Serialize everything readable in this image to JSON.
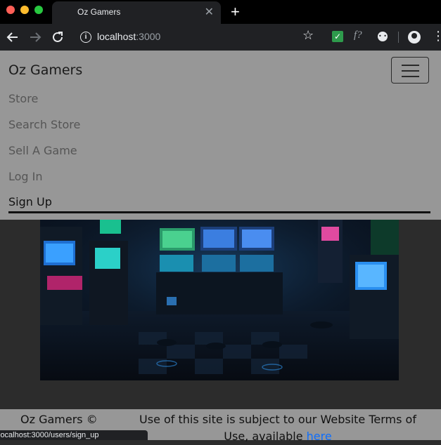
{
  "browser": {
    "tab_title": "Oz Gamers",
    "close_glyph": "✕",
    "new_tab_glyph": "+",
    "url_host": "localhost",
    "url_port": ":3000",
    "status_url": "localhost:3000/users/sign_up",
    "icons": [
      "back-icon",
      "forward-icon",
      "reload-icon",
      "info-icon",
      "star-icon",
      "extension-check-icon",
      "extension-f-icon",
      "extension-circle-icon",
      "profile-icon",
      "menu-icon"
    ]
  },
  "navbar": {
    "brand": "Oz Gamers",
    "links": [
      {
        "label": "Store"
      },
      {
        "label": "Search Store"
      },
      {
        "label": "Sell A Game"
      },
      {
        "label": "Log In"
      },
      {
        "label": "Sign Up"
      }
    ]
  },
  "footer": {
    "brand": "Oz Gamers ©",
    "terms_text": "Use of this site is subject to our Website Terms of Use, available",
    "terms_link": "here"
  },
  "colors": {
    "navbar_bg": "#979797",
    "page_bg": "#2c2c2c",
    "link": "#0d6efd"
  }
}
